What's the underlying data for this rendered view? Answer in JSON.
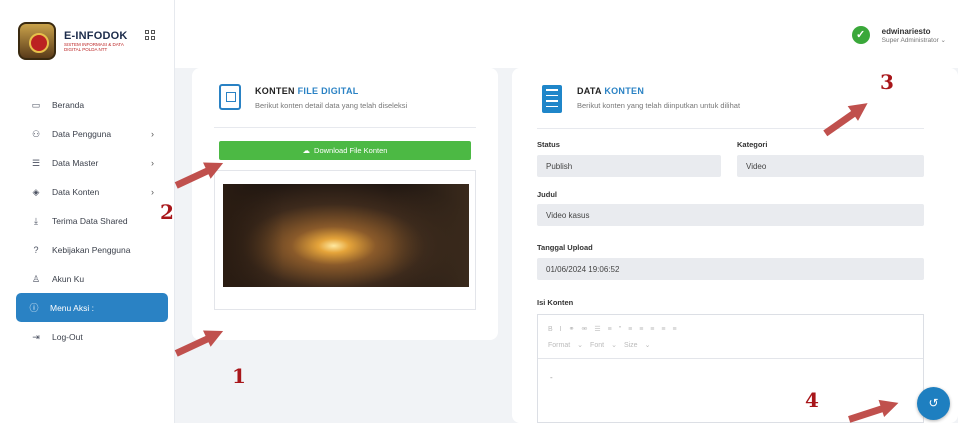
{
  "app": {
    "name": "E-INFODOK",
    "tagline": "SISTEM INFORMASI & DATA DIGITAL POLDA NTT"
  },
  "user": {
    "name": "edwinariesto",
    "role": "Super Administrator ⌄"
  },
  "sidebar": {
    "items": [
      {
        "label": "Beranda",
        "icon": "screen-icon",
        "chev": ""
      },
      {
        "label": "Data Pengguna",
        "icon": "users-icon",
        "chev": "›"
      },
      {
        "label": "Data Master",
        "icon": "database-icon",
        "chev": "›"
      },
      {
        "label": "Data Konten",
        "icon": "layers-icon",
        "chev": "›"
      },
      {
        "label": "Terima Data Shared",
        "icon": "download-icon",
        "chev": ""
      },
      {
        "label": "Kebijakan Pengguna",
        "icon": "help-icon",
        "chev": ""
      },
      {
        "label": "Akun Ku",
        "icon": "user-icon",
        "chev": ""
      },
      {
        "label": "Menu Aksi :",
        "icon": "info-icon",
        "chev": ""
      },
      {
        "label": "Log-Out",
        "icon": "logout-icon",
        "chev": ""
      }
    ]
  },
  "left_card": {
    "title_plain": "KONTEN ",
    "title_accent": "FILE DIGITAL",
    "subtitle": "Berikut konten detail data yang telah diseleksi",
    "download_label": "Download File Konten"
  },
  "right_card": {
    "title_plain": "DATA ",
    "title_accent": "KONTEN",
    "subtitle": "Berikut konten yang telah diinputkan untuk dilihat",
    "status_label": "Status",
    "status_value": "Publish",
    "kategori_label": "Kategori",
    "kategori_value": "Video",
    "judul_label": "Judul",
    "judul_value": "Video kasus",
    "tanggal_label": "Tanggal Upload",
    "tanggal_value": "01/06/2024 19:06:52",
    "isi_label": "Isi Konten",
    "editor_toolbar_row1": [
      "B",
      "I",
      "⚭",
      "⚮",
      "☰",
      "≡",
      "”",
      "≡",
      "≡",
      "≡",
      "≡",
      "≡"
    ],
    "editor_toolbar_row2": [
      "Format",
      "⌄",
      "Font",
      "⌄",
      "Size",
      "⌄"
    ],
    "editor_content": "-"
  },
  "annotations": {
    "n1": "1",
    "n2": "2",
    "n3": "3",
    "n4": "4"
  },
  "colors": {
    "accent": "#2a82c4",
    "download": "#4cb944",
    "arrow": "#c0504d",
    "number": "#a8161a"
  }
}
